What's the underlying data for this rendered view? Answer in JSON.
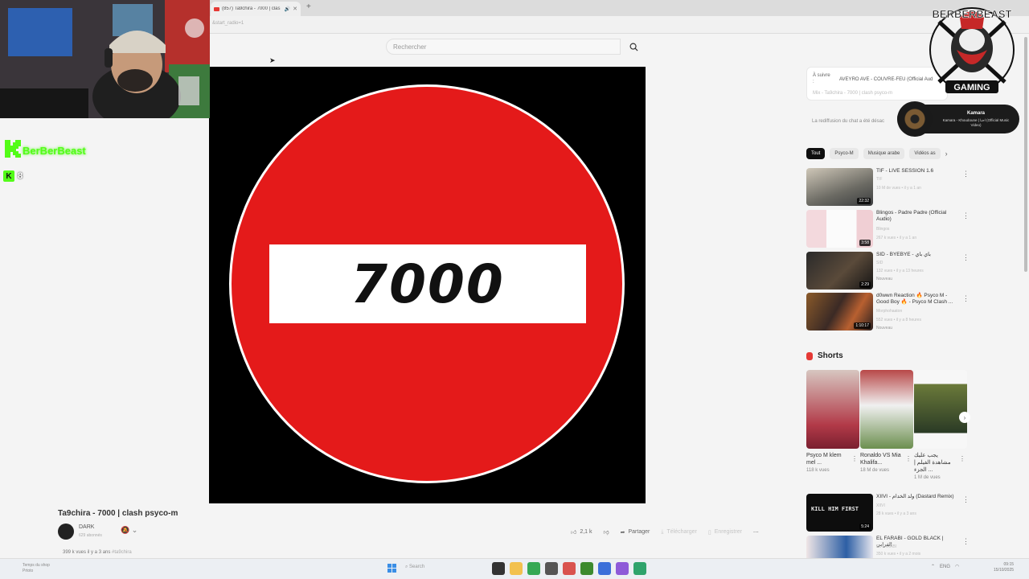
{
  "browser": {
    "tab_title": "(857) Ta9chira - 7000 | clas",
    "address": "&start_radio=1"
  },
  "youtube": {
    "search_placeholder": "Rechercher",
    "video_sign_text": "7000",
    "video_title": "Ta9chira - 7000 | clash psyco-m",
    "channel": {
      "name": "DARK",
      "subscribers": "629 abonnés"
    },
    "actions": {
      "likes": "2,1 k",
      "share": "Partager",
      "download": "Télécharger",
      "save": "Enregistrer"
    },
    "meta": {
      "views_date": "399 k vues  il y a 3 ans",
      "hashtag": "#ta9chira"
    }
  },
  "sidebar": {
    "playlist": {
      "next_label": "À suivre :",
      "next_title": "AVEYRO AVE - COUVRE-FEU (Official Aud",
      "next_sub": "Mix - Ta9chira - 7000 | clash psyco-m"
    },
    "chat_disabled": "La rediffusion du chat a été désac",
    "chips": [
      "Tout",
      "Psyco-M",
      "Musique arabe",
      "Vidéos as"
    ],
    "recommendations": [
      {
        "title": "TIF - LIVE SESSION 1.6",
        "channel": "TIF",
        "views": "10 M de vues • il y a 1 an",
        "duration": "22:32",
        "badge": ""
      },
      {
        "title": "Blingos - Padre Padre (Official Audio)",
        "channel": "Blingos",
        "views": "267 k vues • il y a 1 an",
        "duration": "3:58",
        "badge": ""
      },
      {
        "title": "SID - BYEBYE - باي باي",
        "channel": "SID",
        "views": "132 vues • il y a 13 heures",
        "duration": "2:29",
        "badge": "Nouveau"
      },
      {
        "title": "d0wwn Reaction 🔥 Psyco M - Good Boy 🔥 - Psyco M Clash ...",
        "channel": "Morphohaaton",
        "views": "552 vues • il y a 8 heures",
        "duration": "1:10:17",
        "badge": "Nouveau"
      },
      {
        "title": "XIIVI - ولد الخدام (Dastard Remix)",
        "channel": "XIIVI",
        "views": "28 k vues • il y a 3 ans",
        "duration": "5:24",
        "badge": ""
      },
      {
        "title": "EL FARABI - GOLD BLACK | الفرابي",
        "channel": "EL FARABI",
        "views": "350 k vues • il y a 2 mois",
        "duration": "",
        "badge": ""
      }
    ],
    "shorts_title": "Shorts",
    "shorts": [
      {
        "name": "Psyco M klem mel ...",
        "views": "118 k vues"
      },
      {
        "name": "Ronaldo VS Mia Khalifa...",
        "views": "18 M de vues"
      },
      {
        "name": "يجب عليك مشاهدة الفيلم | الجزء ...",
        "views": "1 M de vues"
      }
    ]
  },
  "overlay": {
    "streamer_name": "BerBerBeast",
    "viewer_count": "8",
    "now_playing_title": "Kamara",
    "now_playing_sub": "Kamara - Khoudoune | احنا (Official Music Video)",
    "logo_text_top": "BERBERBEAST",
    "logo_text_bottom": "GAMING"
  },
  "taskbar": {
    "weather": "Temps du shop\nPrtoto",
    "search": "Search",
    "lang": "ENG",
    "time": "09:15",
    "date": "15/10/2025"
  },
  "colors": {
    "sign_red": "#e41a1a",
    "kick_green": "#53fc18",
    "youtube_red": "#e53935"
  }
}
